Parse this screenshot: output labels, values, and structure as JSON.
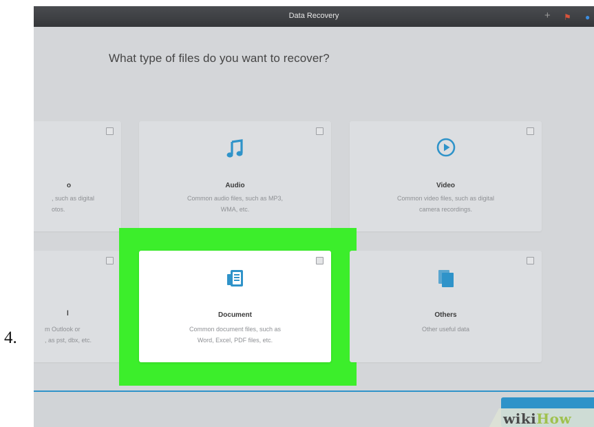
{
  "step_number": "4.",
  "window": {
    "title": "Data Recovery"
  },
  "toolbar": {
    "plus_icon": "plus-icon",
    "flag_icon": "flag-icon",
    "more_icon": "person-icon"
  },
  "heading": "What type of files do you want to recover?",
  "cards": {
    "photo": {
      "icon": "image-icon",
      "label": "o",
      "desc_line1": ", such as digital",
      "desc_line2": "otos.",
      "checked": false
    },
    "audio": {
      "icon": "music-note-icon",
      "label": "Audio",
      "desc_line1": "Common audio files, such as MP3,",
      "desc_line2": "WMA, etc.",
      "checked": false
    },
    "video": {
      "icon": "play-circle-icon",
      "label": "Video",
      "desc_line1": "Common video files, such as digital",
      "desc_line2": "camera recordings.",
      "checked": false
    },
    "email": {
      "icon": "mail-icon",
      "label": "l",
      "desc_line1": "m Outlook or",
      "desc_line2": ", as pst, dbx, etc.",
      "checked": false
    },
    "document": {
      "icon": "document-icon",
      "label": "Document",
      "desc_line1": "Common document files, such as",
      "desc_line2": "Word, Excel, PDF files, etc.",
      "checked": false
    },
    "others": {
      "icon": "files-icon",
      "label": "Others",
      "desc_line1": "Other useful data",
      "checked": false
    }
  },
  "highlight_color": "#3cee2b",
  "accent_color": "#2f93c9",
  "watermark": {
    "part1": "wiki",
    "part2": "How"
  }
}
